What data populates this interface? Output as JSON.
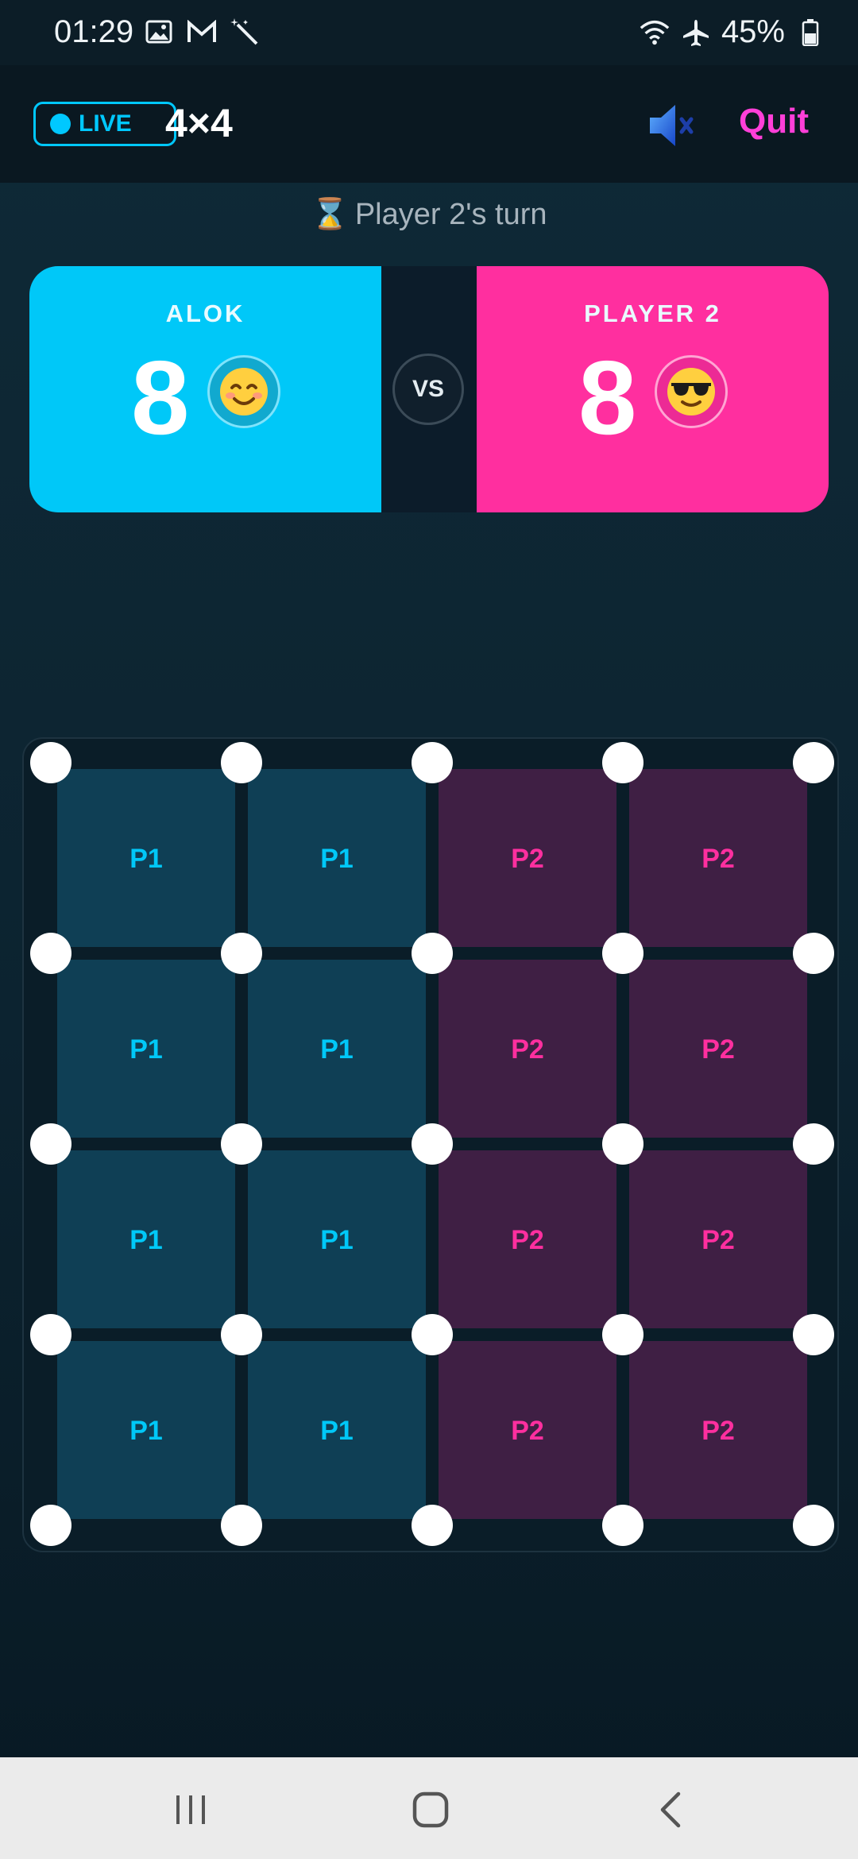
{
  "status_bar": {
    "time": "01:29",
    "left_icons": [
      "image-icon",
      "gmail-icon",
      "magic-wand-icon"
    ],
    "right_icons": [
      "wifi-icon",
      "airplane-icon",
      "battery-icon"
    ],
    "battery": "45%"
  },
  "header": {
    "live_label": "LIVE",
    "grid_size": "4×4",
    "sound_icon": "speaker-muted-icon",
    "quit_label": "Quit"
  },
  "turn_text": "Player 2's turn",
  "turn_icon": "hourglass-icon",
  "players": [
    {
      "name": "ALOK",
      "score": "8",
      "avatar": "😊",
      "color": "#00c8f8"
    },
    {
      "name": "PLAYER 2",
      "score": "8",
      "avatar": "😎",
      "color": "#ff2f9f"
    }
  ],
  "vs_label": "VS",
  "board": {
    "size": 4,
    "colors": {
      "p1": "#00c8f8",
      "p2": "#ff2f9f"
    },
    "horizontal": [
      [
        "p1",
        "p2",
        "p1",
        "p2"
      ],
      [
        "p1",
        "p1",
        "p2",
        "p2"
      ],
      [
        "p1",
        "p1",
        "p2",
        "p2"
      ],
      [
        "p1",
        "p1",
        "p2",
        "p2"
      ],
      [
        "p1",
        "p1",
        "p2",
        "p1"
      ]
    ],
    "vertical": [
      [
        "p1",
        "p2",
        "p1",
        "p2",
        "p1"
      ],
      [
        "p1",
        "p2",
        "p1",
        "p2",
        "p2"
      ],
      [
        "p1",
        "p2",
        "p2",
        "p1",
        "p1"
      ],
      [
        "p2",
        "p1",
        "p1",
        "p2",
        "p2"
      ]
    ],
    "boxes": [
      [
        "P1",
        "P1",
        "P2",
        "P2"
      ],
      [
        "P1",
        "P1",
        "P2",
        "P2"
      ],
      [
        "P1",
        "P1",
        "P2",
        "P2"
      ],
      [
        "P1",
        "P1",
        "P2",
        "P2"
      ]
    ]
  },
  "nav": [
    "recent-apps-icon",
    "home-icon",
    "back-icon"
  ]
}
